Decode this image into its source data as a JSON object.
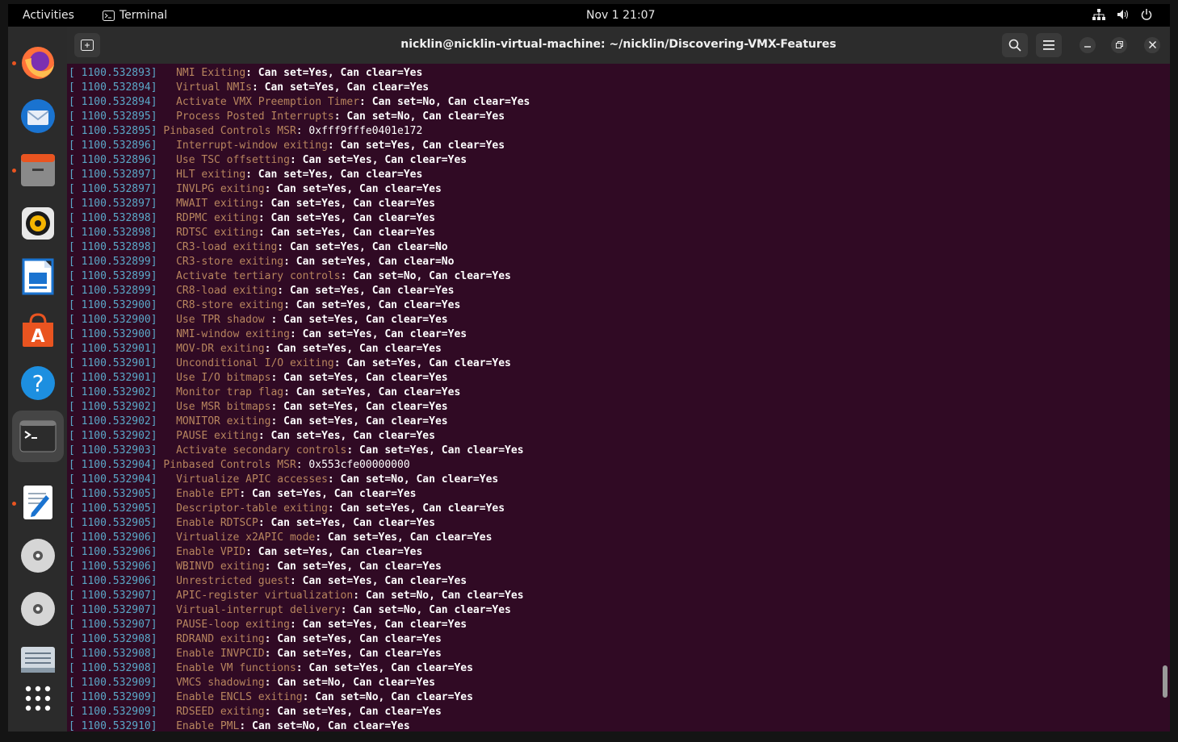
{
  "topbar": {
    "activities": "Activities",
    "app_name": "Terminal",
    "clock": "Nov 1  21:07",
    "system_icons": [
      "network-icon",
      "volume-icon",
      "power-icon"
    ]
  },
  "dock": {
    "items": [
      {
        "name": "firefox",
        "icon": "firefox-icon",
        "running": true
      },
      {
        "name": "thunderbird",
        "icon": "thunderbird-icon",
        "running": false
      },
      {
        "name": "files",
        "icon": "files-icon",
        "running": true
      },
      {
        "name": "rhythmbox",
        "icon": "rhythmbox-icon",
        "running": false
      },
      {
        "name": "writer",
        "icon": "writer-icon",
        "running": false
      },
      {
        "name": "software",
        "icon": "software-icon",
        "running": false
      },
      {
        "name": "help",
        "icon": "help-icon",
        "running": false
      },
      {
        "name": "terminal",
        "icon": "terminal-icon",
        "running": true,
        "active": true
      },
      {
        "name": "text-editor",
        "icon": "text-editor-icon",
        "running": true
      },
      {
        "name": "disc-1",
        "icon": "disc-icon",
        "running": false
      },
      {
        "name": "disc-2",
        "icon": "disc-icon",
        "running": false
      },
      {
        "name": "drive",
        "icon": "drive-icon",
        "running": false
      },
      {
        "name": "show-apps",
        "icon": "app-grid-icon",
        "running": false
      }
    ]
  },
  "window": {
    "title": "nicklin@nicklin-virtual-machine: ~/nicklin/Discovering-VMX-Features"
  },
  "colors": {
    "terminal_bg": "#300a24",
    "timestamp": "#5aa8c8",
    "label": "#b8855e",
    "accent": "#e95420"
  },
  "terminal": {
    "lines": [
      {
        "ts": "[ 1100.532893]",
        "indent": "  ",
        "label": "NMI Exiting",
        "value": ": Can set=Yes, Can clear=Yes"
      },
      {
        "ts": "[ 1100.532894]",
        "indent": "  ",
        "label": "Virtual NMIs",
        "value": ": Can set=Yes, Can clear=Yes"
      },
      {
        "ts": "[ 1100.532894]",
        "indent": "  ",
        "label": "Activate VMX Preemption Timer",
        "value": ": Can set=No, Can clear=Yes"
      },
      {
        "ts": "[ 1100.532895]",
        "indent": "  ",
        "label": "Process Posted Interrupts",
        "value": ": Can set=No, Can clear=Yes"
      },
      {
        "ts": "[ 1100.532895]",
        "indent": "",
        "label": "Pinbased Controls MSR",
        "value": ": 0xfff9fffe0401e172",
        "plain": true
      },
      {
        "ts": "[ 1100.532896]",
        "indent": "  ",
        "label": "Interrupt-window exiting",
        "value": ": Can set=Yes, Can clear=Yes"
      },
      {
        "ts": "[ 1100.532896]",
        "indent": "  ",
        "label": "Use TSC offsetting",
        "value": ": Can set=Yes, Can clear=Yes"
      },
      {
        "ts": "[ 1100.532897]",
        "indent": "  ",
        "label": "HLT exiting",
        "value": ": Can set=Yes, Can clear=Yes"
      },
      {
        "ts": "[ 1100.532897]",
        "indent": "  ",
        "label": "INVLPG exiting",
        "value": ": Can set=Yes, Can clear=Yes"
      },
      {
        "ts": "[ 1100.532897]",
        "indent": "  ",
        "label": "MWAIT exiting",
        "value": ": Can set=Yes, Can clear=Yes"
      },
      {
        "ts": "[ 1100.532898]",
        "indent": "  ",
        "label": "RDPMC exiting",
        "value": ": Can set=Yes, Can clear=Yes"
      },
      {
        "ts": "[ 1100.532898]",
        "indent": "  ",
        "label": "RDTSC exiting",
        "value": ": Can set=Yes, Can clear=Yes"
      },
      {
        "ts": "[ 1100.532898]",
        "indent": "  ",
        "label": "CR3-load exiting",
        "value": ": Can set=Yes, Can clear=No"
      },
      {
        "ts": "[ 1100.532899]",
        "indent": "  ",
        "label": "CR3-store exiting",
        "value": ": Can set=Yes, Can clear=No"
      },
      {
        "ts": "[ 1100.532899]",
        "indent": "  ",
        "label": "Activate tertiary controls",
        "value": ": Can set=No, Can clear=Yes"
      },
      {
        "ts": "[ 1100.532899]",
        "indent": "  ",
        "label": "CR8-load exiting",
        "value": ": Can set=Yes, Can clear=Yes"
      },
      {
        "ts": "[ 1100.532900]",
        "indent": "  ",
        "label": "CR8-store exiting",
        "value": ": Can set=Yes, Can clear=Yes"
      },
      {
        "ts": "[ 1100.532900]",
        "indent": "  ",
        "label": "Use TPR shadow ",
        "value": ": Can set=Yes, Can clear=Yes"
      },
      {
        "ts": "[ 1100.532900]",
        "indent": "  ",
        "label": "NMI-window exiting",
        "value": ": Can set=Yes, Can clear=Yes"
      },
      {
        "ts": "[ 1100.532901]",
        "indent": "  ",
        "label": "MOV-DR exiting",
        "value": ": Can set=Yes, Can clear=Yes"
      },
      {
        "ts": "[ 1100.532901]",
        "indent": "  ",
        "label": "Unconditional I/O exiting",
        "value": ": Can set=Yes, Can clear=Yes"
      },
      {
        "ts": "[ 1100.532901]",
        "indent": "  ",
        "label": "Use I/O bitmaps",
        "value": ": Can set=Yes, Can clear=Yes"
      },
      {
        "ts": "[ 1100.532902]",
        "indent": "  ",
        "label": "Monitor trap flag",
        "value": ": Can set=Yes, Can clear=Yes"
      },
      {
        "ts": "[ 1100.532902]",
        "indent": "  ",
        "label": "Use MSR bitmaps",
        "value": ": Can set=Yes, Can clear=Yes"
      },
      {
        "ts": "[ 1100.532902]",
        "indent": "  ",
        "label": "MONITOR exiting",
        "value": ": Can set=Yes, Can clear=Yes"
      },
      {
        "ts": "[ 1100.532902]",
        "indent": "  ",
        "label": "PAUSE exiting",
        "value": ": Can set=Yes, Can clear=Yes"
      },
      {
        "ts": "[ 1100.532903]",
        "indent": "  ",
        "label": "Activate secondary controls",
        "value": ": Can set=Yes, Can clear=Yes"
      },
      {
        "ts": "[ 1100.532904]",
        "indent": "",
        "label": "Pinbased Controls MSR",
        "value": ": 0x553cfe00000000",
        "plain": true
      },
      {
        "ts": "[ 1100.532904]",
        "indent": "  ",
        "label": "Virtualize APIC accesses",
        "value": ": Can set=No, Can clear=Yes"
      },
      {
        "ts": "[ 1100.532905]",
        "indent": "  ",
        "label": "Enable EPT",
        "value": ": Can set=Yes, Can clear=Yes"
      },
      {
        "ts": "[ 1100.532905]",
        "indent": "  ",
        "label": "Descriptor-table exiting",
        "value": ": Can set=Yes, Can clear=Yes"
      },
      {
        "ts": "[ 1100.532905]",
        "indent": "  ",
        "label": "Enable RDTSCP",
        "value": ": Can set=Yes, Can clear=Yes"
      },
      {
        "ts": "[ 1100.532906]",
        "indent": "  ",
        "label": "Virtualize x2APIC mode",
        "value": ": Can set=Yes, Can clear=Yes"
      },
      {
        "ts": "[ 1100.532906]",
        "indent": "  ",
        "label": "Enable VPID",
        "value": ": Can set=Yes, Can clear=Yes"
      },
      {
        "ts": "[ 1100.532906]",
        "indent": "  ",
        "label": "WBINVD exiting",
        "value": ": Can set=Yes, Can clear=Yes"
      },
      {
        "ts": "[ 1100.532906]",
        "indent": "  ",
        "label": "Unrestricted guest",
        "value": ": Can set=Yes, Can clear=Yes"
      },
      {
        "ts": "[ 1100.532907]",
        "indent": "  ",
        "label": "APIC-register virtualization",
        "value": ": Can set=No, Can clear=Yes"
      },
      {
        "ts": "[ 1100.532907]",
        "indent": "  ",
        "label": "Virtual-interrupt delivery",
        "value": ": Can set=No, Can clear=Yes"
      },
      {
        "ts": "[ 1100.532907]",
        "indent": "  ",
        "label": "PAUSE-loop exiting",
        "value": ": Can set=Yes, Can clear=Yes"
      },
      {
        "ts": "[ 1100.532908]",
        "indent": "  ",
        "label": "RDRAND exiting",
        "value": ": Can set=Yes, Can clear=Yes"
      },
      {
        "ts": "[ 1100.532908]",
        "indent": "  ",
        "label": "Enable INVPCID",
        "value": ": Can set=Yes, Can clear=Yes"
      },
      {
        "ts": "[ 1100.532908]",
        "indent": "  ",
        "label": "Enable VM functions",
        "value": ": Can set=Yes, Can clear=Yes"
      },
      {
        "ts": "[ 1100.532909]",
        "indent": "  ",
        "label": "VMCS shadowing",
        "value": ": Can set=No, Can clear=Yes"
      },
      {
        "ts": "[ 1100.532909]",
        "indent": "  ",
        "label": "Enable ENCLS exiting",
        "value": ": Can set=No, Can clear=Yes"
      },
      {
        "ts": "[ 1100.532909]",
        "indent": "  ",
        "label": "RDSEED exiting",
        "value": ": Can set=Yes, Can clear=Yes"
      },
      {
        "ts": "[ 1100.532910]",
        "indent": "  ",
        "label": "Enable PML",
        "value": ": Can set=No, Can clear=Yes"
      }
    ]
  }
}
